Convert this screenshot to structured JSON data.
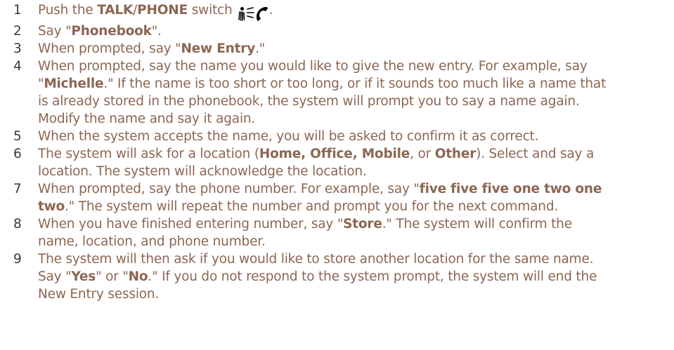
{
  "colors": {
    "text": "#8c6652",
    "number": "#3a3a3a"
  },
  "icons": [
    "voice-talk-icon",
    "phone-handset-icon"
  ],
  "steps": [
    {
      "num": "1",
      "lines": [
        [
          {
            "t": "Push the "
          },
          {
            "t": "TALK",
            "b": true
          },
          {
            "t": "/"
          },
          {
            "t": "PHONE",
            "b": true
          },
          {
            "t": " switch"
          }
        ]
      ],
      "after_icons": "."
    },
    {
      "num": "2",
      "lines": [
        [
          {
            "t": "Say \""
          },
          {
            "t": "Phonebook",
            "b": true
          },
          {
            "t": "\"."
          }
        ]
      ]
    },
    {
      "num": "3",
      "lines": [
        [
          {
            "t": "When prompted, say \""
          },
          {
            "t": "New Entry",
            "b": true
          },
          {
            "t": ".\""
          }
        ]
      ]
    },
    {
      "num": "4",
      "lines": [
        [
          {
            "t": "When prompted, say the name you would like to give the new entry. For example, say"
          }
        ],
        [
          {
            "t": "\""
          },
          {
            "t": "Michelle",
            "b": true
          },
          {
            "t": ".\" If the name is too short or too long, or if it sounds too much like a name that"
          }
        ],
        [
          {
            "t": "is already stored in the phonebook, the system will prompt you to say a name again."
          }
        ],
        [
          {
            "t": "Modify the name and say it again."
          }
        ]
      ]
    },
    {
      "num": "5",
      "lines": [
        [
          {
            "t": "When the system accepts the name, you will be asked to confirm it as correct."
          }
        ]
      ]
    },
    {
      "num": "6",
      "lines": [
        [
          {
            "t": "The system will ask for a location ("
          },
          {
            "t": "Home, Office, Mobile",
            "b": true
          },
          {
            "t": ", or "
          },
          {
            "t": "Other",
            "b": true
          },
          {
            "t": "). Select and say a"
          }
        ],
        [
          {
            "t": "location. The system will acknowledge the location."
          }
        ]
      ]
    },
    {
      "num": "7",
      "lines": [
        [
          {
            "t": "When prompted, say the phone number. For example, say \""
          },
          {
            "t": "five five five one two one",
            "b": true
          }
        ],
        [
          {
            "t": "two",
            "b": true
          },
          {
            "t": ".\" The system will repeat the number and prompt you for the next command."
          }
        ]
      ]
    },
    {
      "num": "8",
      "lines": [
        [
          {
            "t": "When you have finished entering number, say \""
          },
          {
            "t": "Store",
            "b": true
          },
          {
            "t": ".\" The system will confirm the"
          }
        ],
        [
          {
            "t": "name, location, and phone number."
          }
        ]
      ]
    },
    {
      "num": "9",
      "lines": [
        [
          {
            "t": "The system will then ask if you would like to store another location for the same name."
          }
        ],
        [
          {
            "t": "Say \""
          },
          {
            "t": "Yes",
            "b": true
          },
          {
            "t": "\" or \""
          },
          {
            "t": "No",
            "b": true
          },
          {
            "t": ".\" If you do not respond to the system prompt, the system will end the"
          }
        ],
        [
          {
            "t": "New Entry session."
          }
        ]
      ]
    }
  ]
}
